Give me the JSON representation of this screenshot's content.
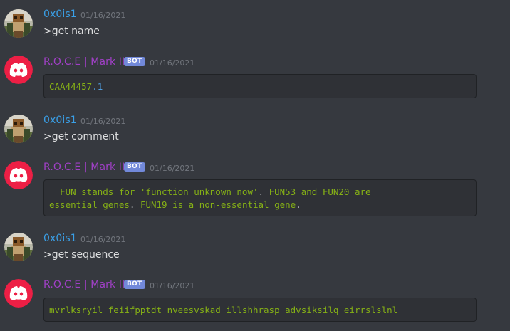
{
  "messages": [
    {
      "author": "0x0is1",
      "is_bot": false,
      "timestamp": "01/16/2021",
      "text": ">get name"
    },
    {
      "author": "R.O.C.E | Mark II",
      "is_bot": true,
      "bot_tag": "BOT",
      "timestamp": "01/16/2021",
      "code": {
        "main": "CAA44457",
        "suffix": ".1"
      }
    },
    {
      "author": "0x0is1",
      "is_bot": false,
      "timestamp": "01/16/2021",
      "text": ">get comment"
    },
    {
      "author": "R.O.C.E | Mark II",
      "is_bot": true,
      "bot_tag": "BOT",
      "timestamp": "01/16/2021",
      "code": {
        "line1": "  FUN stands for 'function unknown now'",
        "line1_end": ". ",
        "line1_b": "FUN53 and FUN20 are",
        "line2": "essential genes",
        "line2_dot": ". ",
        "line2_b": "FUN19 is a non-essential gene",
        "line2_end": "."
      }
    },
    {
      "author": "0x0is1",
      "is_bot": false,
      "timestamp": "01/16/2021",
      "text": ">get sequence"
    },
    {
      "author": "R.O.C.E | Mark II",
      "is_bot": true,
      "bot_tag": "BOT",
      "timestamp": "01/16/2021",
      "code": {
        "sequence": "mvrlksryil feiifpptdt nveesvskad illshhrasp advsiksilq eirrslslnl"
      }
    }
  ],
  "colors": {
    "background": "#36393f",
    "user_name": "#3aa0e8",
    "bot_name": "#a040c6",
    "bot_tag": "#7289da",
    "code_text": "#85b016",
    "code_number": "#4f9de0",
    "discord_red": "#ed1f45"
  },
  "icons": {
    "user_avatar": "pixel-character-avatar",
    "bot_avatar": "discord-logo-icon"
  }
}
